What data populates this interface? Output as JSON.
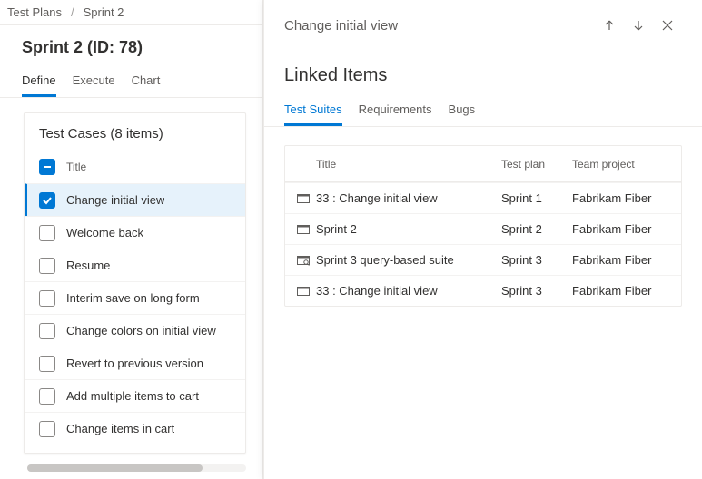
{
  "breadcrumb": {
    "root": "Test Plans",
    "current": "Sprint 2"
  },
  "page": {
    "title": "Sprint 2 (ID: 78)"
  },
  "main_tabs": [
    "Define",
    "Execute",
    "Chart"
  ],
  "main_tabs_active": 0,
  "test_cases": {
    "header": "Test Cases (8 items)",
    "col_label": "Title",
    "items": [
      {
        "title": "Change initial view",
        "selected": true
      },
      {
        "title": "Welcome back",
        "selected": false
      },
      {
        "title": "Resume",
        "selected": false
      },
      {
        "title": "Interim save on long form",
        "selected": false
      },
      {
        "title": "Change colors on initial view",
        "selected": false
      },
      {
        "title": "Revert to previous version",
        "selected": false
      },
      {
        "title": "Add multiple items to cart",
        "selected": false
      },
      {
        "title": "Change items in cart",
        "selected": false
      }
    ]
  },
  "panel": {
    "title": "Change initial view",
    "section": "Linked Items",
    "tabs": [
      "Test Suites",
      "Requirements",
      "Bugs"
    ],
    "tabs_active": 0,
    "cols": {
      "title": "Title",
      "plan": "Test plan",
      "team": "Team project"
    },
    "rows": [
      {
        "icon": "static-suite",
        "title": "33 : Change initial view",
        "plan": "Sprint 1",
        "team": "Fabrikam Fiber"
      },
      {
        "icon": "static-suite",
        "title": "Sprint 2",
        "plan": "Sprint 2",
        "team": "Fabrikam Fiber"
      },
      {
        "icon": "query-suite",
        "title": "Sprint 3 query-based suite",
        "plan": "Sprint 3",
        "team": "Fabrikam Fiber"
      },
      {
        "icon": "static-suite",
        "title": "33 : Change initial view",
        "plan": "Sprint 3",
        "team": "Fabrikam Fiber"
      }
    ]
  }
}
